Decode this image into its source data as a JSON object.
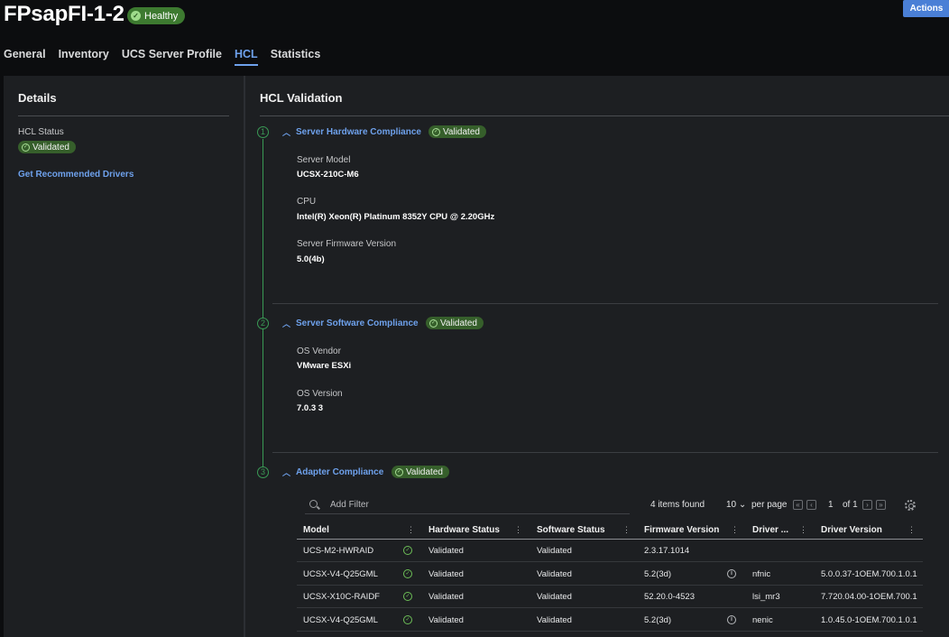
{
  "header": {
    "title": "FPsapFI-1-2",
    "health": "Healthy",
    "actions": "Actions"
  },
  "tabs": [
    {
      "label": "General"
    },
    {
      "label": "Inventory"
    },
    {
      "label": "UCS Server Profile"
    },
    {
      "label": "HCL",
      "active": true
    },
    {
      "label": "Statistics"
    }
  ],
  "details": {
    "title": "Details",
    "hcl_status_label": "HCL Status",
    "hcl_status_value": "Validated",
    "recommended_link": "Get Recommended Drivers"
  },
  "hcl": {
    "title": "HCL Validation",
    "sections": [
      {
        "num": "1",
        "title": "Server Hardware Compliance",
        "status": "Validated",
        "fields": [
          {
            "label": "Server Model",
            "value": "UCSX-210C-M6"
          },
          {
            "label": "CPU",
            "value": "Intel(R) Xeon(R) Platinum 8352Y CPU @ 2.20GHz"
          },
          {
            "label": "Server Firmware Version",
            "value": "5.0(4b)"
          }
        ]
      },
      {
        "num": "2",
        "title": "Server Software Compliance",
        "status": "Validated",
        "fields": [
          {
            "label": "OS Vendor",
            "value": "VMware ESXi"
          },
          {
            "label": "OS Version",
            "value": "7.0.3 3"
          }
        ]
      },
      {
        "num": "3",
        "title": "Adapter Compliance",
        "status": "Validated"
      }
    ]
  },
  "table": {
    "filter_placeholder": "Add Filter",
    "items_found": "4 items found",
    "page_size": "10",
    "per_page": "per page",
    "page": "1",
    "of_pages": "of 1",
    "columns": [
      "Model",
      "Hardware Status",
      "Software Status",
      "Firmware Version",
      "Driver ...",
      "Driver Version"
    ],
    "rows": [
      {
        "model": "UCS-M2-HWRAID",
        "hw": "Validated",
        "sw": "Validated",
        "fw": "2.3.17.1014",
        "info": false,
        "driver": "",
        "driver_version": ""
      },
      {
        "model": "UCSX-V4-Q25GML",
        "hw": "Validated",
        "sw": "Validated",
        "fw": "5.2(3d)",
        "info": true,
        "driver": "nfnic",
        "driver_version": "5.0.0.37-1OEM.700.1.0.1"
      },
      {
        "model": "UCSX-X10C-RAIDF",
        "hw": "Validated",
        "sw": "Validated",
        "fw": "52.20.0-4523",
        "info": false,
        "driver": "lsi_mr3",
        "driver_version": "7.720.04.00-1OEM.700.1"
      },
      {
        "model": "UCSX-V4-Q25GML",
        "hw": "Validated",
        "sw": "Validated",
        "fw": "5.2(3d)",
        "info": true,
        "driver": "nenic",
        "driver_version": "1.0.45.0-1OEM.700.1.0.1"
      }
    ]
  },
  "colors": {
    "accent": "#6ea1ec",
    "success": "#3d7a30",
    "panel": "#1d1f22"
  }
}
